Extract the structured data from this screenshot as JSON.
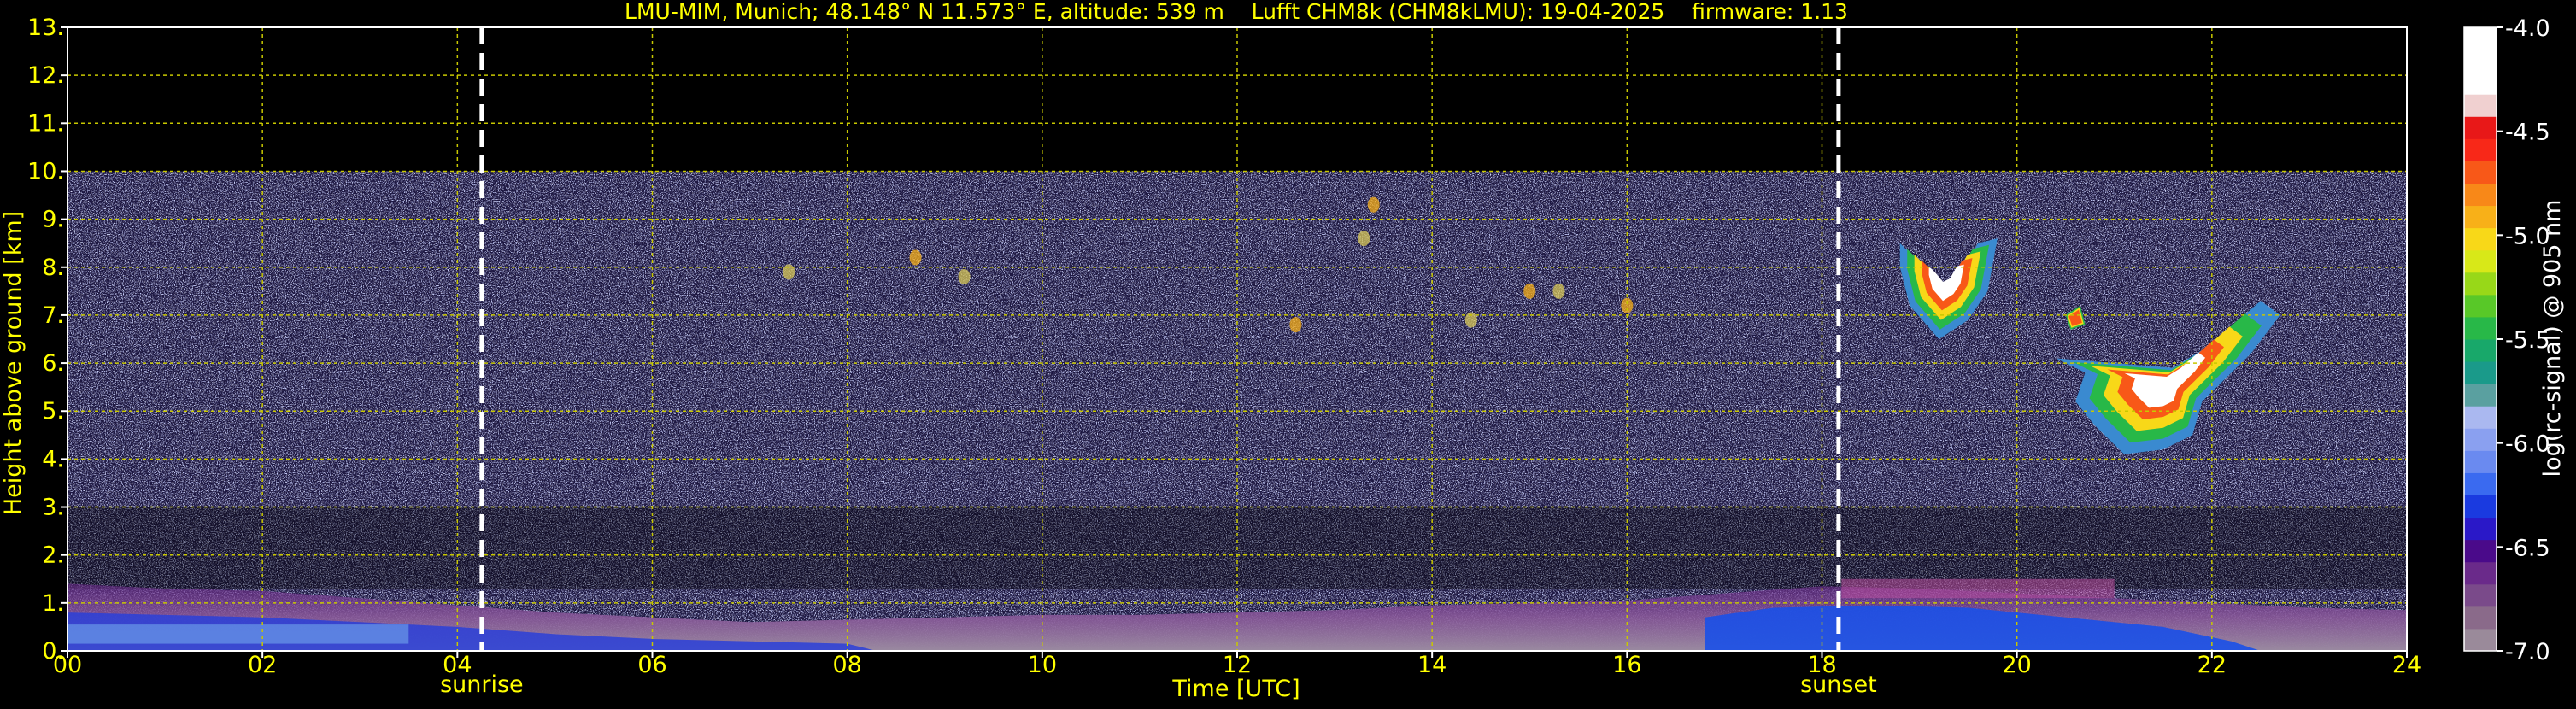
{
  "chart_data": {
    "type": "heatmap",
    "title": "LMU-MIM, Munich; 48.148° N 11.573° E, altitude: 539 m    Lufft CHM8k (CHM8kLMU): 19-04-2025    firmware: 1.13",
    "xlabel": "Time [UTC]",
    "ylabel": "Height above ground [km]",
    "colorbar_label": "log(rc-signal) @ 905 nm",
    "xlim": [
      0,
      24
    ],
    "ylim": [
      0,
      13
    ],
    "x_ticks": [
      0,
      2,
      4,
      6,
      8,
      10,
      12,
      14,
      16,
      18,
      20,
      22,
      24
    ],
    "x_tick_labels": [
      "00",
      "02",
      "04",
      "06",
      "08",
      "10",
      "12",
      "14",
      "16",
      "18",
      "20",
      "22",
      "24"
    ],
    "y_ticks": [
      0,
      1,
      2,
      3,
      4,
      5,
      6,
      7,
      8,
      9,
      10,
      11,
      12,
      13
    ],
    "y_tick_labels": [
      "0.",
      "1.",
      "2.",
      "3.",
      "4.",
      "5.",
      "6.",
      "7.",
      "8.",
      "9.",
      "10.",
      "11.",
      "12.",
      "13."
    ],
    "grid": true,
    "colorbar": {
      "vmin": -7.0,
      "vmax": -4.0,
      "ticks": [
        -7.0,
        -6.5,
        -6.0,
        -5.5,
        -5.0,
        -4.5,
        -4.0
      ],
      "tick_labels": [
        "-7.0",
        "-6.5",
        "-6.0",
        "-5.5",
        "-5.0",
        "-4.5",
        "-4.0"
      ],
      "colors": [
        "#9a8a9a",
        "#8a6a8a",
        "#7a4a8a",
        "#6a2a8a",
        "#4a0a8a",
        "#2a18c8",
        "#1a3ae0",
        "#3a6af0",
        "#6a8af0",
        "#8aa0f0",
        "#aab8f0",
        "#5aa0a0",
        "#1a9a8a",
        "#18a86a",
        "#28b848",
        "#58c828",
        "#98d818",
        "#d8e818",
        "#f8d818",
        "#f8b018",
        "#f88818",
        "#f85818",
        "#f82818",
        "#e81818",
        "#f0d0d0",
        "#ffffff",
        "#ffffff",
        "#ffffff"
      ]
    },
    "annotations": [
      {
        "text": "sunrise",
        "x": 4.25
      },
      {
        "text": "sunset",
        "x": 18.17
      }
    ],
    "data_range_top_km": 10.0,
    "features": [
      {
        "name": "boundary layer aerosol",
        "t_start": 0,
        "t_end": 24,
        "h_bottom": 0,
        "h_top": 1.4
      },
      {
        "name": "mid-level cloud",
        "t_start": 18.8,
        "t_end": 19.8,
        "h_bottom": 6.6,
        "h_top": 8.5
      },
      {
        "name": "mid-level cloud",
        "t_start": 20.3,
        "t_end": 22.7,
        "h_bottom": 4.1,
        "h_top": 7.5
      }
    ],
    "colors": {
      "background": "#000000",
      "text": "#ffff00",
      "grid": "#c8c800",
      "terminator": "#ffffff"
    }
  }
}
